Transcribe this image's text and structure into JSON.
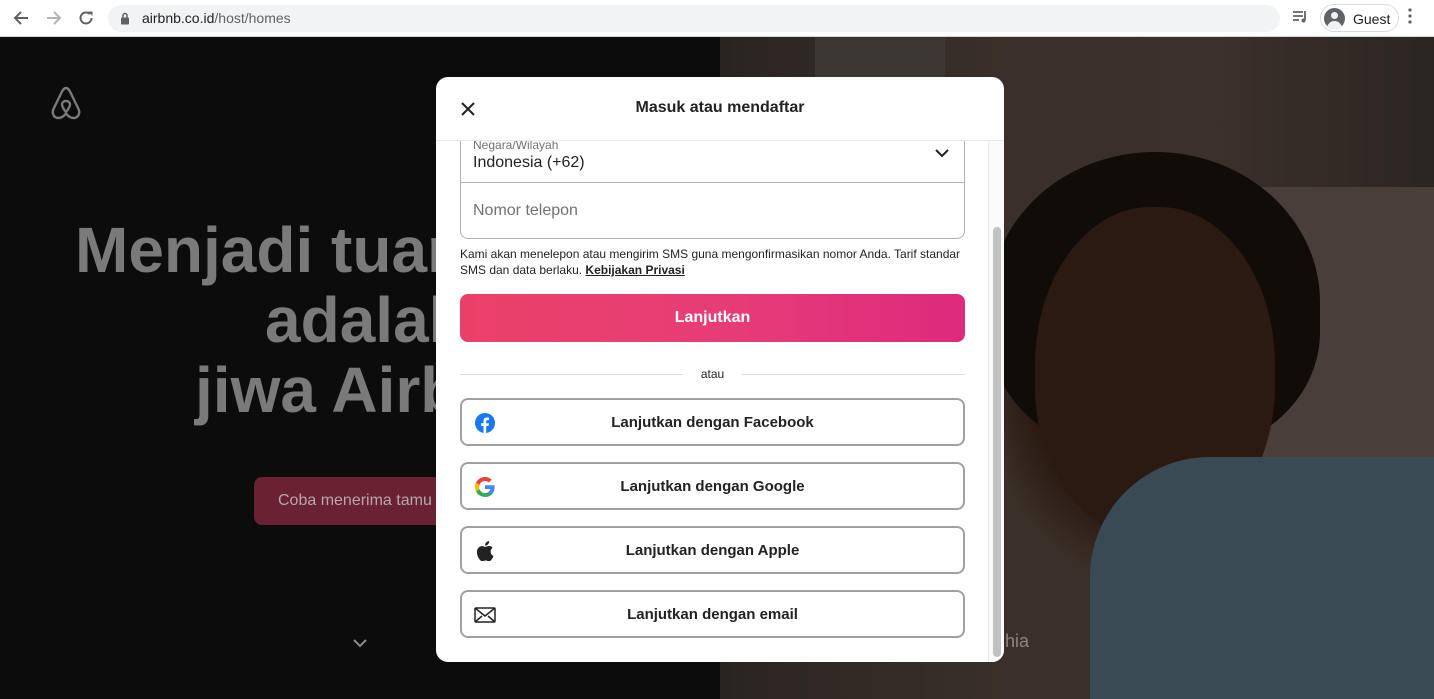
{
  "browser": {
    "url_host": "airbnb.co.id",
    "url_path": "/host/homes",
    "profile_label": "Guest"
  },
  "page": {
    "hero_line1": "Menjadi tuan",
    "hero_line2": "adalah",
    "hero_line3": "jiwa Airb",
    "cta_label": "Coba menerima tamu",
    "caption_partial": "hia"
  },
  "modal": {
    "title": "Masuk atau mendaftar",
    "country_label": "Negara/Wilayah",
    "country_value": "Indonesia (+62)",
    "phone_placeholder": "Nomor telepon",
    "notice_text": "Kami akan menelepon atau mengirim SMS guna mengonfirmasikan nomor Anda. Tarif standar SMS dan data berlaku.",
    "privacy_link": "Kebijakan Privasi",
    "continue_label": "Lanjutkan",
    "divider_text": "atau",
    "social": [
      {
        "label": "Lanjutkan dengan Facebook",
        "icon": "facebook-icon"
      },
      {
        "label": "Lanjutkan dengan Google",
        "icon": "google-icon"
      },
      {
        "label": "Lanjutkan dengan Apple",
        "icon": "apple-icon"
      },
      {
        "label": "Lanjutkan dengan email",
        "icon": "email-icon"
      }
    ]
  },
  "colors": {
    "brand": "#e61e4d",
    "text": "#222222",
    "border": "#b0b0b0"
  }
}
